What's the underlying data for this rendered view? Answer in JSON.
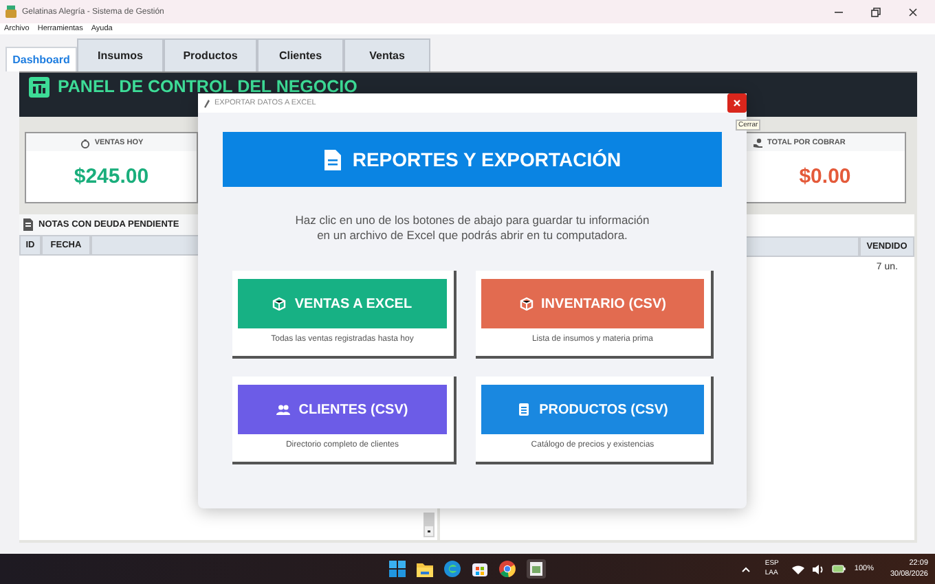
{
  "window": {
    "title": "Gelatinas Alegría - Sistema de Gestión"
  },
  "menu": [
    "Archivo",
    "Herramientas",
    "Ayuda"
  ],
  "tabs": [
    {
      "label": "Dashboard",
      "selected": true
    },
    {
      "label": "Insumos",
      "selected": false
    },
    {
      "label": "Productos",
      "selected": false
    },
    {
      "label": "Clientes",
      "selected": false
    },
    {
      "label": "Ventas",
      "selected": false
    }
  ],
  "header": {
    "title": "PANEL DE CONTROL DEL NEGOCIO"
  },
  "cards": [
    {
      "label": "VENTAS HOY",
      "value": "$245.00",
      "color": "#1aae7c",
      "kind": "bag"
    },
    {
      "label": "TOTAL POR COBRAR",
      "value": "$0.00",
      "color": "#e45a3a",
      "kind": "hand"
    }
  ],
  "debt_panel": {
    "title": "NOTAS CON DEUDA PENDIENTE",
    "columns": [
      "ID",
      "FECHA"
    ]
  },
  "products_panel": {
    "columns": [
      "VENDIDO"
    ],
    "rows": [
      [
        "7 un."
      ]
    ]
  },
  "dialog": {
    "title": "EXPORTAR DATOS A EXCEL",
    "close_tooltip": "Cerrar",
    "banner": "REPORTES Y EXPORTACIÓN",
    "description": [
      "Haz clic en uno de los botones de abajo para guardar tu información",
      "en un archivo de Excel que podrás abrir en tu computadora."
    ],
    "options": [
      {
        "label": "VENTAS A EXCEL",
        "caption": "Todas las ventas registradas hasta hoy",
        "color": "#17b184",
        "kind": "box"
      },
      {
        "label": "INVENTARIO (CSV)",
        "caption": "Lista de insumos y materia prima",
        "color": "#e26b50",
        "kind": "box"
      },
      {
        "label": "CLIENTES (CSV)",
        "caption": "Directorio completo de clientes",
        "color": "#6c5ce7",
        "kind": "people"
      },
      {
        "label": "PRODUCTOS (CSV)",
        "caption": "Catálogo de precios y existencias",
        "color": "#1a88e0",
        "kind": "list"
      }
    ]
  },
  "taskbar": {
    "language": "ESP",
    "region": "LAA",
    "battery": "100%",
    "time": "22:09",
    "date": "30/08/2026"
  }
}
